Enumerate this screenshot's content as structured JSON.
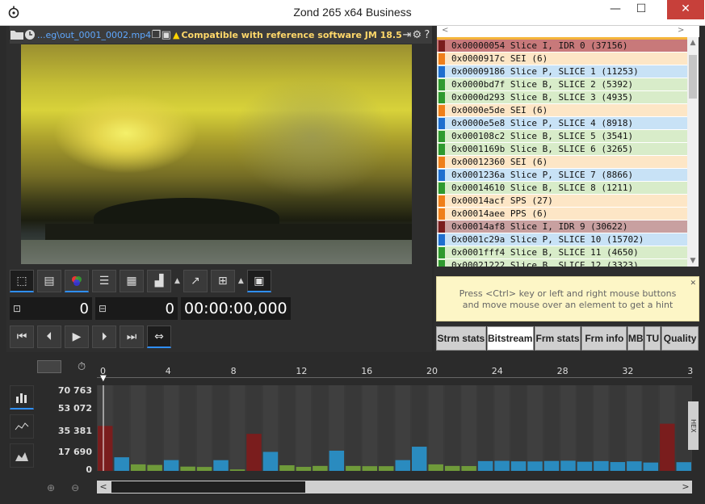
{
  "window": {
    "title": "Zond 265 x64 Business",
    "minimize": "—",
    "maximize": "☐",
    "close": "✕"
  },
  "toolbar": {
    "file_path": "...eg\\out_0001_0002.mp4",
    "compat_text": "Compatible with reference software JM 18.5"
  },
  "controls": {
    "frame_counter": "0",
    "frame_counter2": "0",
    "timecode": "00:00:00,000"
  },
  "nal_list": [
    {
      "text": "0x00000054 Slice I, IDR 0 (37156)",
      "bg": "#c8797a",
      "mark": "#7a1d1d"
    },
    {
      "text": "0x0000917c SEI (6)",
      "bg": "#fde6c6",
      "mark": "#ef7f1a"
    },
    {
      "text": "0x00009186 Slice P, SLICE 1 (11253)",
      "bg": "#c8e2f6",
      "mark": "#1f6fcf"
    },
    {
      "text": "0x0000bd7f Slice B, SLICE 2 (5392)",
      "bg": "#d8ecc9",
      "mark": "#2f9a2f"
    },
    {
      "text": "0x0000d293 Slice B, SLICE 3 (4935)",
      "bg": "#d8ecc9",
      "mark": "#2f9a2f"
    },
    {
      "text": "0x0000e5de SEI (6)",
      "bg": "#fde6c6",
      "mark": "#ef7f1a"
    },
    {
      "text": "0x0000e5e8 Slice P, SLICE 4 (8918)",
      "bg": "#c8e2f6",
      "mark": "#1f6fcf"
    },
    {
      "text": "0x000108c2 Slice B, SLICE 5 (3541)",
      "bg": "#d8ecc9",
      "mark": "#2f9a2f"
    },
    {
      "text": "0x0001169b Slice B, SLICE 6 (3265)",
      "bg": "#d8ecc9",
      "mark": "#2f9a2f"
    },
    {
      "text": "0x00012360 SEI (6)",
      "bg": "#fde6c6",
      "mark": "#ef7f1a"
    },
    {
      "text": "0x0001236a Slice P, SLICE 7 (8866)",
      "bg": "#c8e2f6",
      "mark": "#1f6fcf"
    },
    {
      "text": "0x00014610 Slice B, SLICE 8 (1211)",
      "bg": "#d8ecc9",
      "mark": "#2f9a2f"
    },
    {
      "text": "0x00014acf SPS (27)",
      "bg": "#fde6c6",
      "mark": "#ef7f1a"
    },
    {
      "text": "0x00014aee PPS (6)",
      "bg": "#fde6c6",
      "mark": "#ef7f1a"
    },
    {
      "text": "0x00014af8 Slice I, IDR 9 (30622)",
      "bg": "#c8a0a0",
      "mark": "#7a1d1d"
    },
    {
      "text": "0x0001c29a Slice P, SLICE 10 (15702)",
      "bg": "#c8e2f6",
      "mark": "#1f6fcf"
    },
    {
      "text": "0x0001fff4 Slice B, SLICE 11 (4650)",
      "bg": "#d8ecc9",
      "mark": "#2f9a2f"
    },
    {
      "text": "0x00021222 Slice B, SLICE 12 (3323)",
      "bg": "#d8ecc9",
      "mark": "#2f9a2f"
    }
  ],
  "hint": "Press <Ctrl> key or left and right mouse buttons and move mouse over an element to get a hint",
  "tabs": [
    {
      "label": "Strm stats",
      "selected": false
    },
    {
      "label": "Bitstream",
      "selected": true
    },
    {
      "label": "Frm stats",
      "selected": false
    },
    {
      "label": "Frm info",
      "selected": false
    },
    {
      "label": "MB",
      "selected": false
    },
    {
      "label": "TU",
      "selected": false
    },
    {
      "label": "Quality",
      "selected": false
    }
  ],
  "timeline": {
    "hex_label": "HEX",
    "ticks": [
      "0",
      "4",
      "8",
      "12",
      "16",
      "20",
      "24",
      "28",
      "32",
      "3"
    ],
    "yticks": [
      "70 763",
      "53 072",
      "35 381",
      "17 690",
      "0"
    ]
  },
  "colors": {
    "I": "#7a1d1d",
    "P": "#2a8bbf",
    "B": "#6f9a3a",
    "accent": "#2f8fff"
  },
  "chart_data": {
    "type": "bar",
    "ylim": [
      0,
      70763
    ],
    "x": [
      0,
      1,
      2,
      3,
      4,
      5,
      6,
      7,
      8,
      9,
      10,
      11,
      12,
      13,
      14,
      15,
      16,
      17,
      18,
      19,
      20,
      21,
      22,
      23,
      24,
      25,
      26,
      27,
      28,
      29,
      30,
      31,
      32,
      33,
      34,
      35
    ],
    "frame_types": [
      "I",
      "P",
      "B",
      "B",
      "P",
      "B",
      "B",
      "P",
      "B",
      "I",
      "P",
      "B",
      "B",
      "B",
      "P",
      "B",
      "B",
      "B",
      "P",
      "P",
      "B",
      "B",
      "B",
      "P",
      "P",
      "P",
      "P",
      "P",
      "P",
      "P",
      "P",
      "P",
      "P",
      "P",
      "I",
      "P"
    ],
    "values": [
      37156,
      11253,
      5392,
      4935,
      8918,
      3541,
      3265,
      8866,
      1211,
      30622,
      15702,
      4650,
      3323,
      4100,
      16700,
      4100,
      3900,
      3900,
      8900,
      20000,
      5400,
      4100,
      4000,
      8100,
      8300,
      7900,
      7800,
      8200,
      8400,
      7600,
      8100,
      7300,
      7900,
      6900,
      39000,
      7200
    ]
  }
}
